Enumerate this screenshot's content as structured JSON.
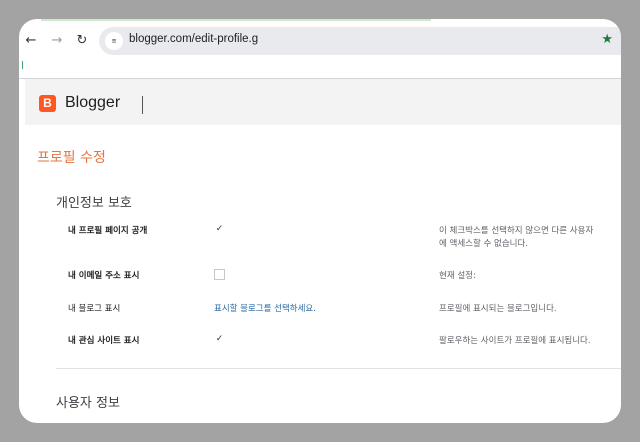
{
  "browser": {
    "url": "blogger.com/edit-profile.g",
    "site_info_icon": "tune-icon",
    "star_icon": "star-icon"
  },
  "header": {
    "logo_letter": "B",
    "logo_text": "Blogger",
    "brand_color": "#ff5722"
  },
  "page": {
    "title": "프로필 수정",
    "title_color": "#e8743b"
  },
  "privacy": {
    "title": "개인정보 보호",
    "rows": [
      {
        "label": "내 프로필 페이지 공개",
        "checked": true,
        "help_line1": "이 체크박스를 선택하지 않으면 다른 사용자",
        "help_line2": "에 액세스할 수 없습니다."
      },
      {
        "label": "내 이메일 주소 표시",
        "checked": false,
        "help_line1": "현재 설정:"
      },
      {
        "label": "내 블로그 표시",
        "link": "표시할 블로그를 선택하세요.",
        "help_line1": "프로필에 표시되는 블로그입니다."
      },
      {
        "label": "내 관심 사이트 표시",
        "checked": true,
        "help_line1": "팔로우하는 사이트가 프로필에 표시됩니다."
      }
    ]
  },
  "user_info": {
    "title": "사용자 정보"
  }
}
